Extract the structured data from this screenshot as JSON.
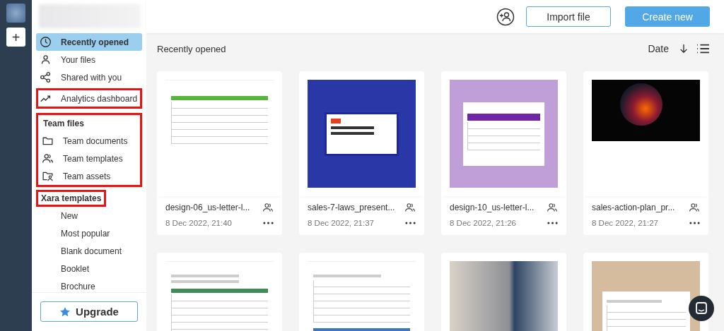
{
  "rail": {
    "add_label": "+"
  },
  "header": {
    "buttons": [
      {
        "label": "Import file",
        "kind": "secondary"
      },
      {
        "label": "Create new",
        "kind": "primary"
      }
    ]
  },
  "sidebar": {
    "nav": [
      {
        "label": "Recently opened",
        "kind": "clock",
        "selected": true,
        "highlighted": false
      },
      {
        "label": "Your files",
        "kind": "person",
        "selected": false,
        "highlighted": false
      },
      {
        "label": "Shared with you",
        "kind": "share",
        "selected": false,
        "highlighted": false
      },
      {
        "label": "Analytics dashboard",
        "kind": "trend",
        "selected": false,
        "highlighted": true
      }
    ],
    "sections": [
      {
        "title": "Team files",
        "highlighted": true,
        "title_highlighted": false,
        "items": [
          {
            "label": "Team documents",
            "kind": "folder"
          },
          {
            "label": "Team templates",
            "kind": "people"
          },
          {
            "label": "Team assets",
            "kind": "folder-person"
          }
        ]
      },
      {
        "title": "Xara templates",
        "highlighted": false,
        "title_highlighted": true,
        "items": [
          {
            "label": "New",
            "kind": "plain"
          },
          {
            "label": "Most popular",
            "kind": "plain"
          },
          {
            "label": "Blank document",
            "kind": "plain"
          },
          {
            "label": "Booklet",
            "kind": "plain"
          },
          {
            "label": "Brochure",
            "kind": "plain"
          }
        ]
      }
    ],
    "upgrade": {
      "label": "Upgrade"
    }
  },
  "main": {
    "title": "Recently opened",
    "sort": {
      "label": "Date"
    },
    "files": [
      {
        "name": "design-06_us-letter-l...",
        "date": "8 Dec 2022, 21:40",
        "shared": true,
        "kind": "sheet"
      },
      {
        "name": "sales-7-laws_present...",
        "date": "8 Dec 2022, 21:37",
        "shared": true,
        "kind": "slides"
      },
      {
        "name": "design-10_us-letter-l...",
        "date": "8 Dec 2022, 21:26",
        "shared": true,
        "kind": "document"
      },
      {
        "name": "sales-action-plan_pr...",
        "date": "8 Dec 2022, 21:27",
        "shared": true,
        "kind": "presentation"
      }
    ],
    "more_files": [
      {
        "kind": "report"
      },
      {
        "kind": "form"
      },
      {
        "kind": "photo"
      },
      {
        "kind": "checklist"
      }
    ]
  }
}
